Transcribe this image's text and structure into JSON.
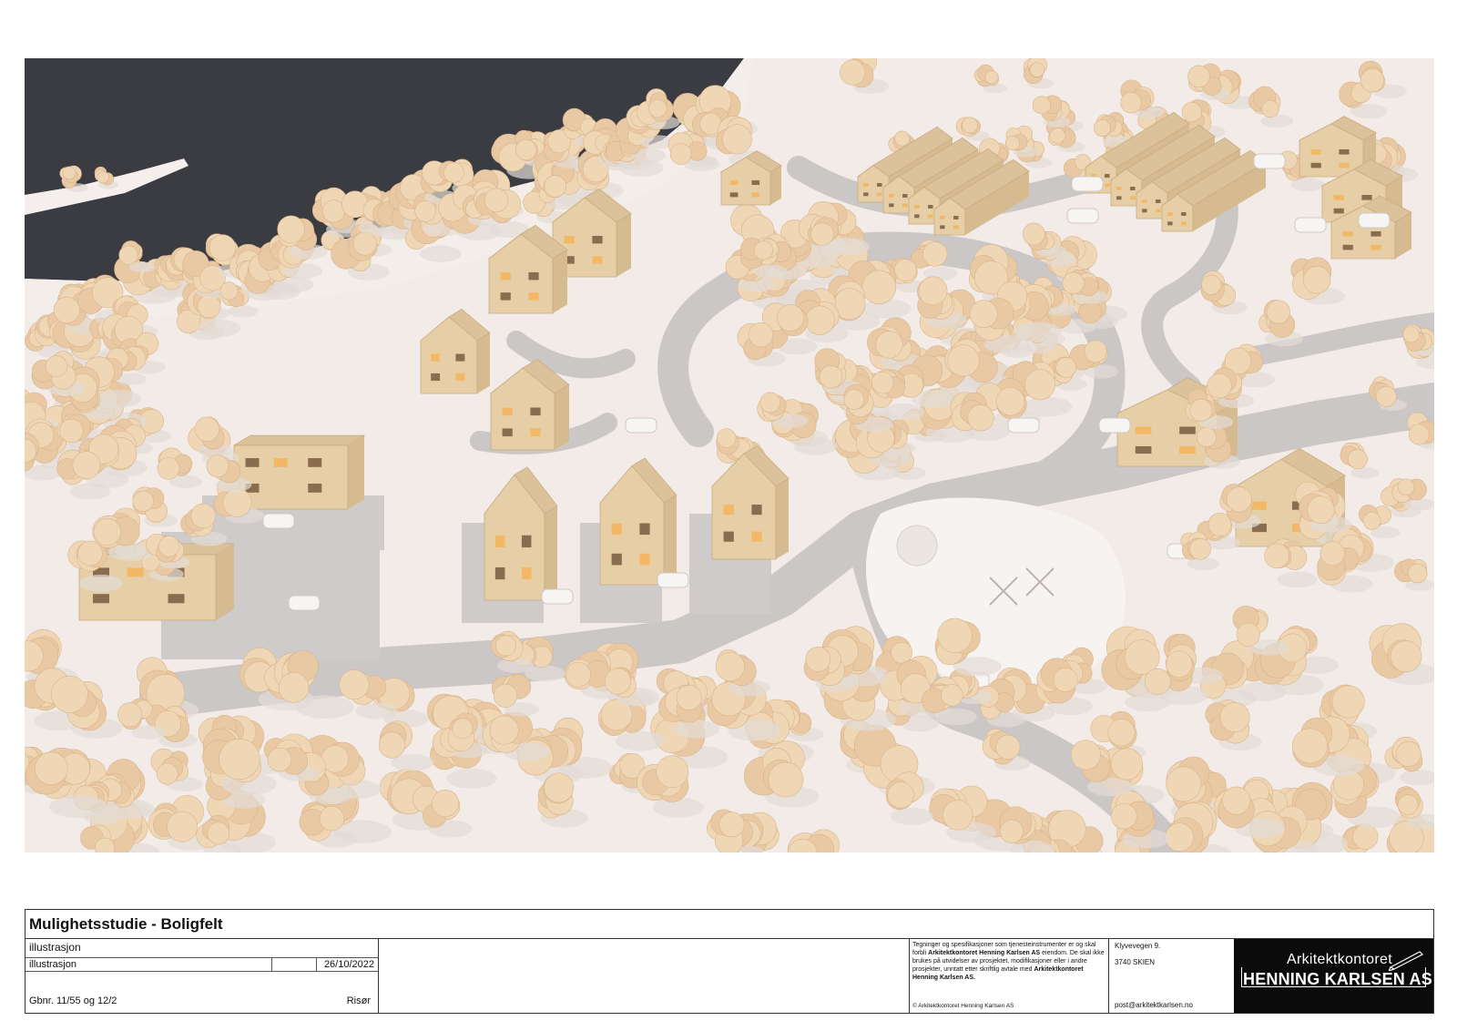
{
  "title_block": {
    "title": "Mulighetsstudie - Boligfelt",
    "drawing_type": "illustrasjon",
    "sheet_name": "illustrasjon",
    "date": "26/10/2022",
    "property": "Gbnr. 11/55 og 12/2",
    "place": "Risør"
  },
  "legal": {
    "text_a": "Tegninger og spesifikasjoner som tjenesteinstrumenter er og skal forbli",
    "company_bold": "Arkitektkontoret Henning Karlsen AS",
    "text_b": "eiendom. De skal ikke brukes på utvidelser av prosjektet, modifikasjoner eller i andre prosjekter, unntatt etter skriftlig avtale med",
    "company_bold_end": "Arkitektkontoret Henning Karlsen AS.",
    "copyright": "© Arkitektkontoret Henning Karlsen AS"
  },
  "address": {
    "street": "Klyvevegen 9.",
    "city": "3740  SKIEN",
    "email": "post@arkitektkarlsen.no"
  },
  "logo": {
    "line1": "Arkitektkontoret",
    "line2": "HENNING KARLSEN AS"
  },
  "colors": {
    "water": "#3a3c42",
    "ground": "#f3ece8",
    "road": "#c9c6c6",
    "wood": "#e6cfa6",
    "tree": "#e9c9a3",
    "logo_bg": "#0b0b0b"
  }
}
